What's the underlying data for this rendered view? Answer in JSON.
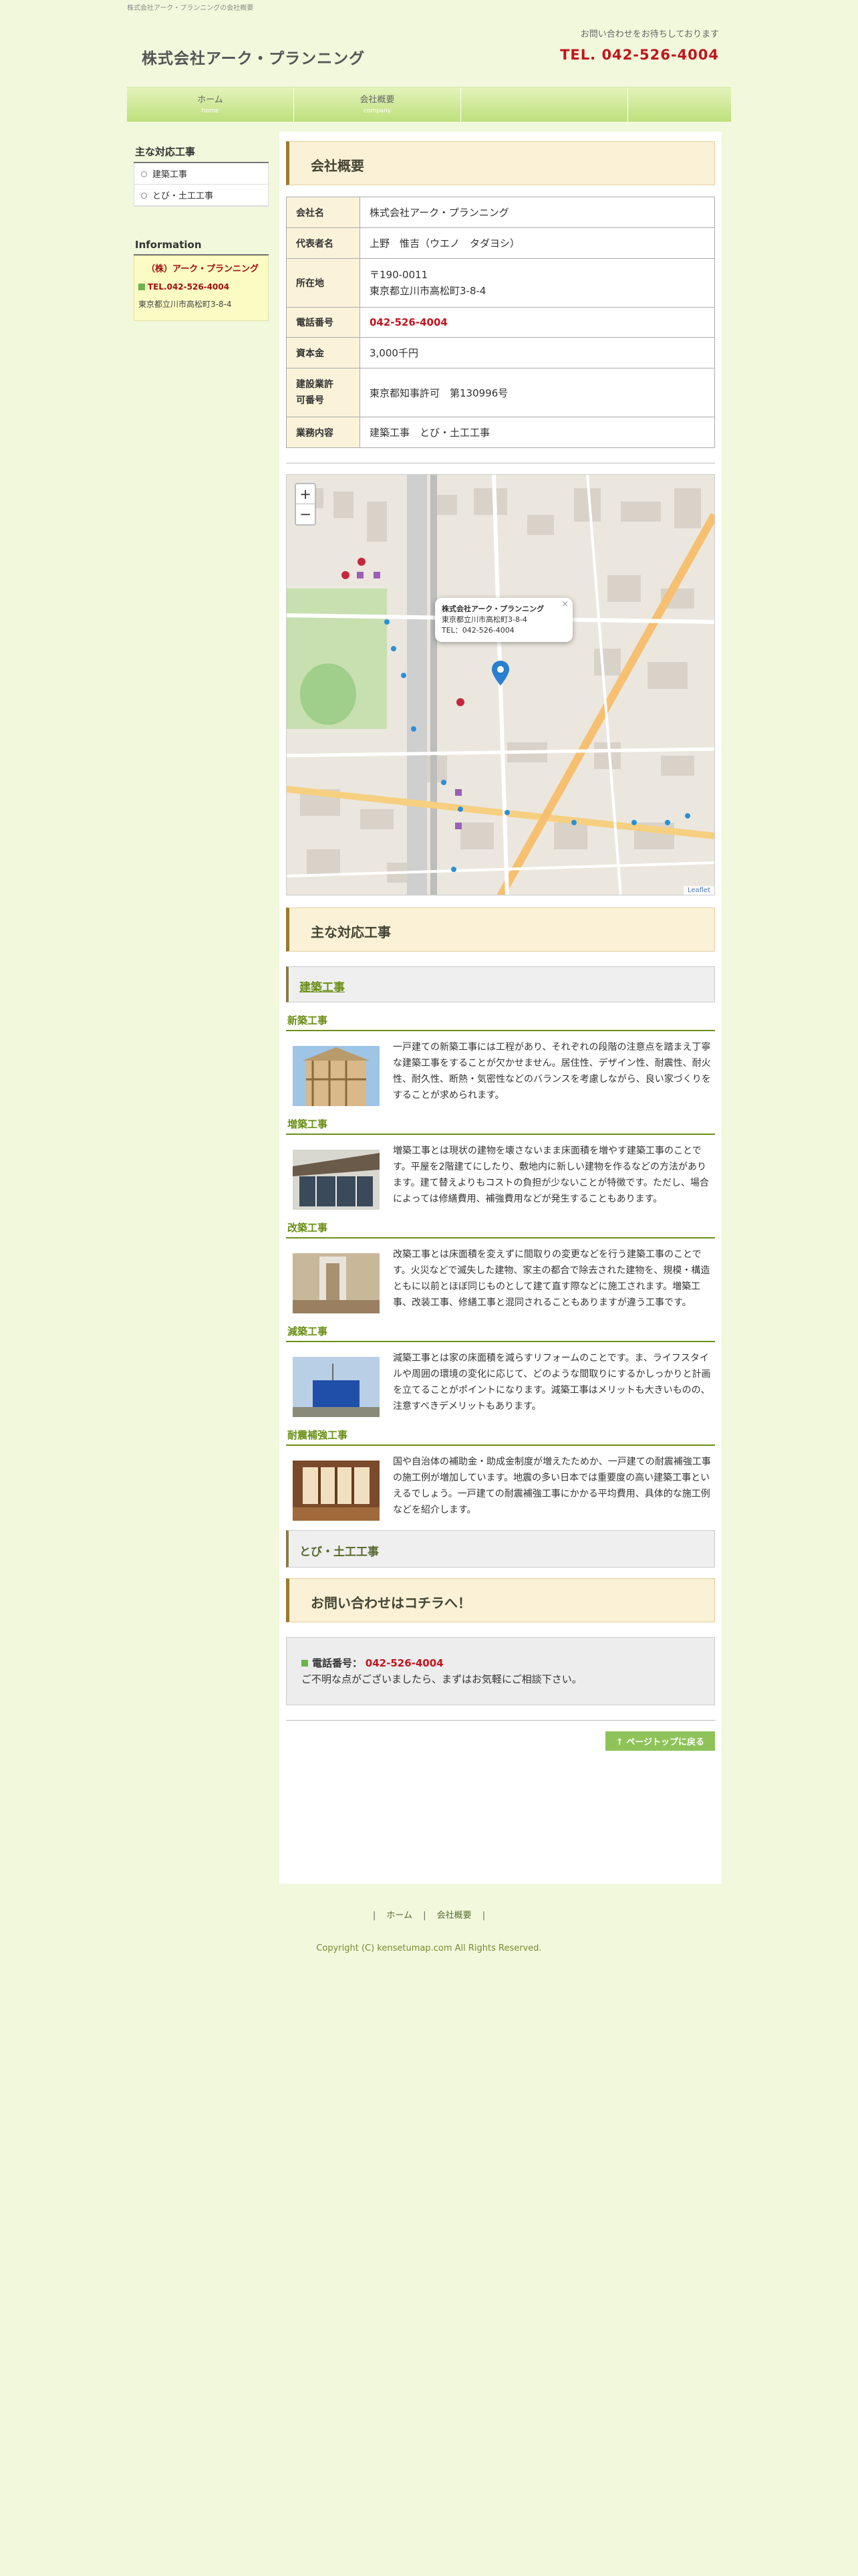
{
  "top_note": "株式会社アーク・プランニングの会社概要",
  "header": {
    "logo": "株式会社アーク・プランニング",
    "contact_note": "お問い合わせをお待ちしております",
    "tel": "TEL. 042-526-4004"
  },
  "nav": [
    {
      "label": "ホーム",
      "sub": "home"
    },
    {
      "label": "会社概要",
      "sub": "company"
    }
  ],
  "sidebar": {
    "services_title": "主な対応工事",
    "services": [
      "建築工事",
      "とび・土工工事"
    ],
    "info_title": "Information",
    "info_name": "（株）アーク・プランニング",
    "info_tel": "TEL.042-526-4004",
    "info_address": "東京都立川市高松町3-8-4"
  },
  "company": {
    "heading": "会社概要",
    "rows": [
      {
        "label": "会社名",
        "value": "株式会社アーク・プランニング"
      },
      {
        "label": "代表者名",
        "value": "上野　惟吉（ウエノ　タダヨシ）"
      },
      {
        "label": "所在地",
        "value": "〒190-0011",
        "value2": "東京都立川市高松町3-8-4"
      },
      {
        "label": "電話番号",
        "value": "042-526-4004"
      },
      {
        "label": "資本金",
        "value": "3,000千円"
      },
      {
        "label": "建設業許",
        "label2": "可番号",
        "value": "東京都知事許可　第130996号"
      },
      {
        "label": "業務内容",
        "value": "建築工事　とび・土工工事"
      }
    ]
  },
  "map": {
    "popup_name": "株式会社アーク・プランニング",
    "popup_address": "東京都立川市高松町3-8-4",
    "popup_tel": "TEL：042-526-4004",
    "zoom_in": "+",
    "zoom_out": "−",
    "attribution": "Leaflet"
  },
  "services": {
    "heading": "主な対応工事",
    "construction_heading": "建築工事",
    "items": [
      {
        "title": "新築工事",
        "text": "一戸建ての新築工事には工程があり、それぞれの段階の注意点を踏まえ丁寧な建築工事をすることが欠かせません。居住性、デザイン性、耐震性、耐火性、耐久性、断熱・気密性などのバランスを考慮しながら、良い家づくりをすることが求められます。"
      },
      {
        "title": "増築工事",
        "text": "増築工事とは現状の建物を壊さないまま床面積を増やす建築工事のことです。平屋を2階建てにしたり、敷地内に新しい建物を作るなどの方法があります。建て替えよりもコストの負担が少ないことが特徴です。ただし、場合によっては修繕費用、補強費用などが発生することもあります。"
      },
      {
        "title": "改築工事",
        "text": "改築工事とは床面積を変えずに間取りの変更などを行う建築工事のことです。火災などで滅失した建物、家主の都合で除去された建物を、規模・構造ともに以前とほぼ同じものとして建て直す際などに施工されます。増築工事、改装工事、修繕工事と混同されることもありますが違う工事です。"
      },
      {
        "title": "減築工事",
        "text": "減築工事とは家の床面積を減らすリフォームのことです。ま、ライフスタイルや周囲の環境の変化に応じて、どのような間取りにするかしっかりと計画を立てることがポイントになります。減築工事はメリットも大きいものの、注意すべきデメリットもあります。"
      },
      {
        "title": "耐震補強工事",
        "text": "国や自治体の補助金・助成金制度が増えたためか、一戸建ての耐震補強工事の施工例が増加しています。地震の多い日本では重要度の高い建築工事といえるでしょう。一戸建ての耐震補強工事にかかる平均費用、具体的な施工例などを紹介します。"
      }
    ],
    "tobi_heading": "とび・土工工事"
  },
  "contact": {
    "heading": "お問い合わせはコチラへ！",
    "phone_label": "電話番号：",
    "phone": "042-526-4004",
    "note": "ご不明な点がございましたら、まずはお気軽にご相談下さい。"
  },
  "page_top": "↑ ページトップに戻る",
  "footer": {
    "sep": "|",
    "links": [
      "ホーム",
      "会社概要"
    ],
    "copyright": "Copyright (C) kensetumap.com All Rights Reserved."
  }
}
